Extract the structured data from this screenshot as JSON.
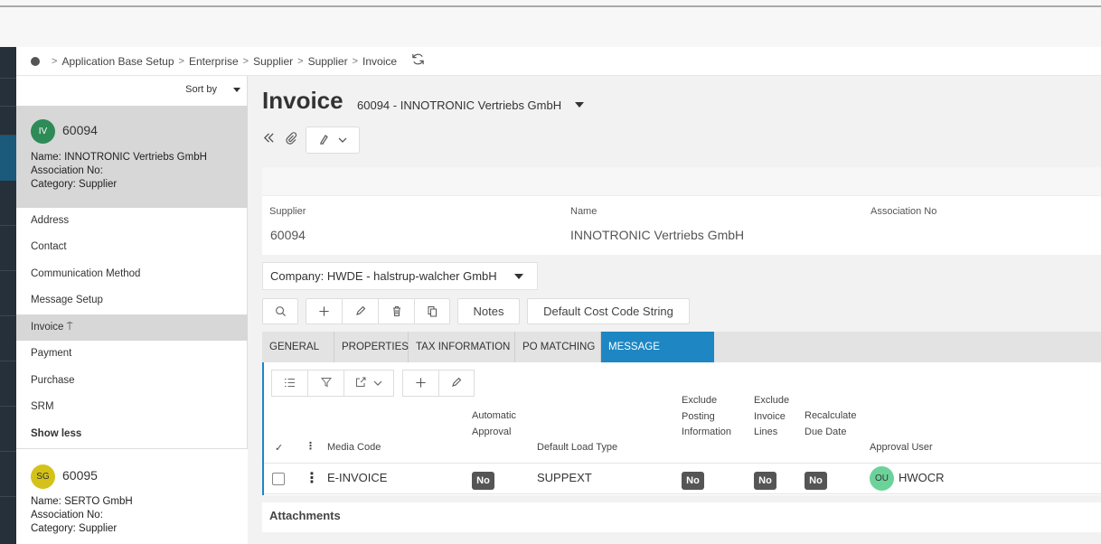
{
  "breadcrumb": {
    "items": [
      "Application Base Setup",
      "Enterprise",
      "Supplier",
      "Supplier",
      "Invoice"
    ],
    "separator": ">"
  },
  "sidebar": {
    "sort_label": "Sort by",
    "records": [
      {
        "initials": "IV",
        "avatar_color": "#2e8b57",
        "id": "60094",
        "name_line": "Name:  INNOTRONIC Vertriebs GmbH",
        "assoc_line": "Association No:",
        "category_line": "Category:  Supplier"
      },
      {
        "initials": "SG",
        "avatar_color": "#d4c21a",
        "id": "60095",
        "name_line": "Name:  SERTO GmbH",
        "assoc_line": "Association No:",
        "category_line": "Category:  Supplier"
      }
    ],
    "nav": [
      {
        "label": "Address"
      },
      {
        "label": "Contact"
      },
      {
        "label": "Communication Method"
      },
      {
        "label": "Message Setup"
      },
      {
        "label": "Invoice ⍑"
      },
      {
        "label": "Payment"
      },
      {
        "label": "Purchase"
      },
      {
        "label": "SRM"
      },
      {
        "label": "Show less"
      }
    ]
  },
  "page": {
    "title": "Invoice",
    "subtitle": "60094 - INNOTRONIC Vertriebs GmbH",
    "header": {
      "fields": [
        {
          "label": "Supplier",
          "value": "60094"
        },
        {
          "label": "Name",
          "value": "INNOTRONIC Vertriebs GmbH"
        },
        {
          "label": "Association No",
          "value": ""
        }
      ]
    },
    "company_selector": "Company: HWDE - halstrup-walcher GmbH",
    "buttons": {
      "notes": "Notes",
      "default_cost_code": "Default Cost Code String"
    },
    "tabs": [
      {
        "label": "GENERAL"
      },
      {
        "label": "PROPERTIES"
      },
      {
        "label": "TAX INFORMATION"
      },
      {
        "label": "PO MATCHING"
      },
      {
        "label": "MESSAGE DEFAULTS"
      }
    ],
    "grid": {
      "columns": [
        "Media Code",
        "Automatic Approval",
        "Default Load Type",
        "Exclude Posting Information",
        "Exclude Invoice Lines",
        "Recalculate Due Date",
        "Approval User"
      ],
      "rows": [
        {
          "media_code": "E-INVOICE",
          "automatic_approval": "No",
          "default_load_type": "SUPPEXT",
          "exclude_posting": "No",
          "exclude_invoice_lines": "No",
          "recalculate_due_date": "No",
          "approval_user_initials": "OU",
          "approval_user": "HWOCR"
        }
      ]
    },
    "attachments_label": "Attachments"
  },
  "colors": {
    "accent": "#1e86c3",
    "rail": "#26303b",
    "selected_bg": "#d7d7d7"
  }
}
